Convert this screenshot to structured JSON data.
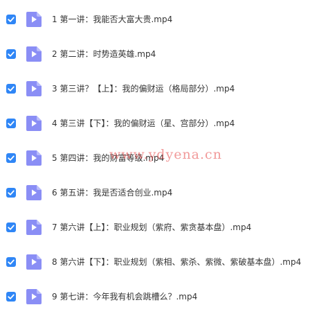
{
  "colors": {
    "checkbox": "#2f86f6",
    "video_icon": "#8a8ef5",
    "text": "#333333",
    "watermark": "#e64646"
  },
  "icons": {
    "checkbox": "checkmark-icon",
    "file": "video-file-icon"
  },
  "files": [
    {
      "name": "1 第一讲：我能否大富大贵.mp4",
      "checked": true
    },
    {
      "name": "2 第二讲：时势造英雄.mp4",
      "checked": true
    },
    {
      "name": "3 第三讲？【上】：我的偏财运（格局部分）.mp4",
      "checked": true
    },
    {
      "name": "4 第三讲【下】：我的偏财运（星、宫部分）.mp4",
      "checked": true
    },
    {
      "name": "5 第四讲：我的财富等级.mp4",
      "checked": true
    },
    {
      "name": "6 第五讲：我是否适合创业.mp4",
      "checked": true
    },
    {
      "name": "7 第六讲【上】：职业规划（紫府、紫贪基本盘）.mp4",
      "checked": true
    },
    {
      "name": "8 第六讲【下】：职业规划（紫相、紫杀、紫微、紫破基本盘）.mp4",
      "checked": true
    },
    {
      "name": "9 第七讲：今年我有机会跳槽么？.mp4",
      "checked": true
    }
  ],
  "watermark": "www.ydyena.cn"
}
